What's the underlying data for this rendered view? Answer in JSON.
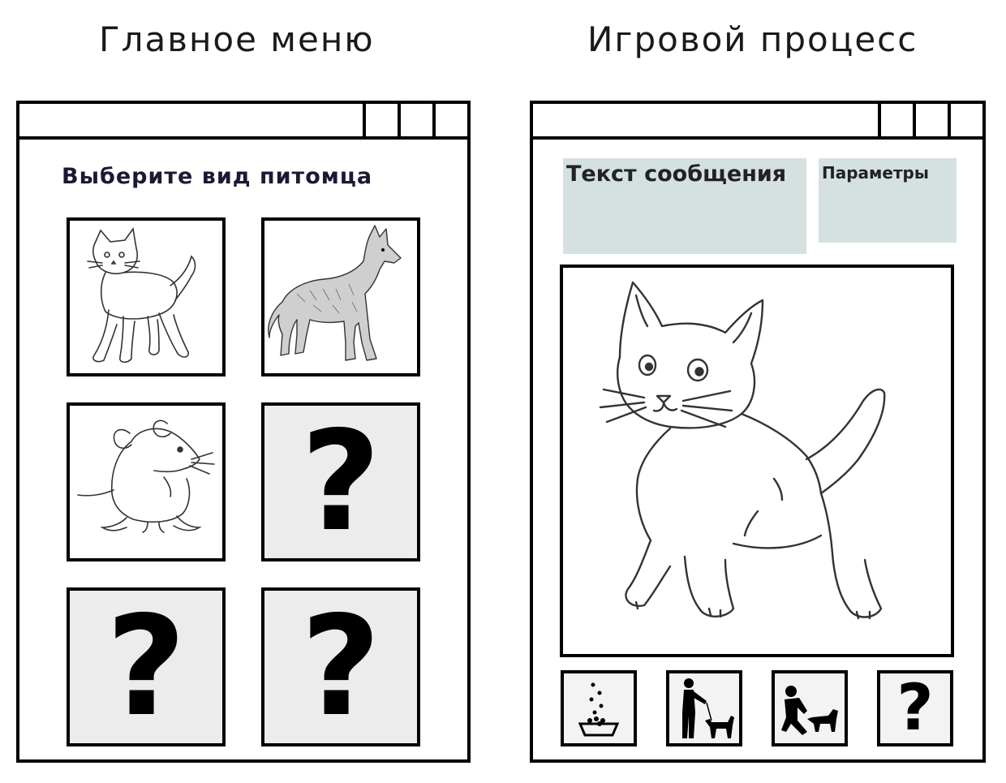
{
  "headings": {
    "main_menu": "Главное меню",
    "gameplay": "Игровой процесс"
  },
  "main_menu": {
    "prompt": "Выберите вид питомца",
    "pets": [
      {
        "name": "cat",
        "icon": "cat-icon"
      },
      {
        "name": "wolf",
        "icon": "wolf-icon"
      },
      {
        "name": "mouse",
        "icon": "mouse-icon"
      },
      {
        "name": "locked",
        "label": "?"
      },
      {
        "name": "locked",
        "label": "?"
      },
      {
        "name": "locked",
        "label": "?"
      }
    ]
  },
  "gameplay": {
    "message_box": "Текст сообщения",
    "parameters_box": "Параметры",
    "pet_image": "cat-icon",
    "actions": [
      {
        "name": "feed",
        "icon": "food-bowl-icon"
      },
      {
        "name": "walk",
        "icon": "walk-dog-icon"
      },
      {
        "name": "play",
        "icon": "play-dog-icon"
      },
      {
        "name": "unknown",
        "label": "?"
      }
    ]
  },
  "colors": {
    "info_box_fill": "#d5e1e1",
    "locked_tile_fill": "#ececec",
    "border": "#000000"
  }
}
